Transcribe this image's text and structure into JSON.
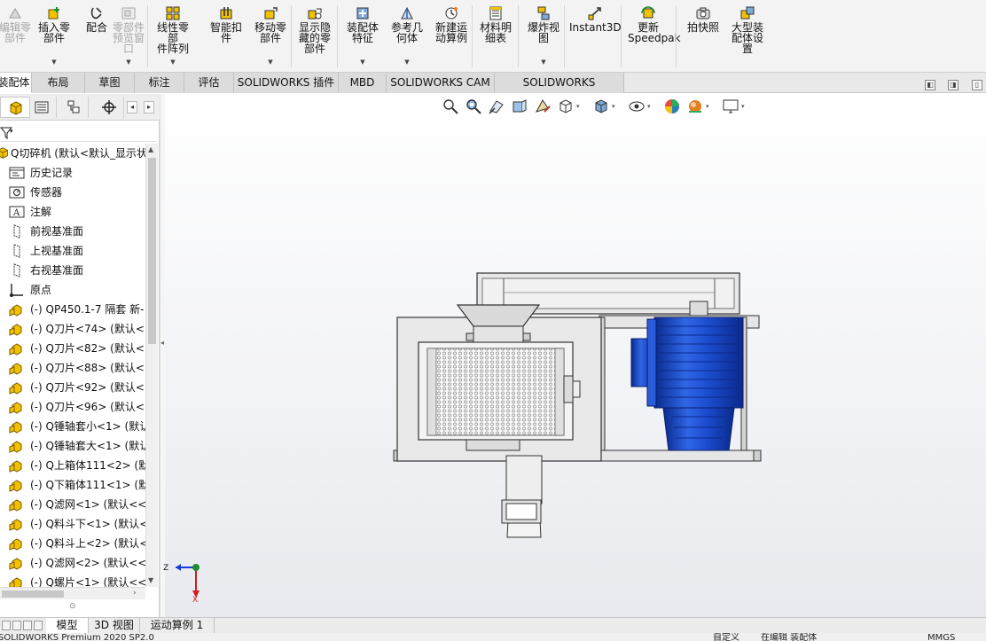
{
  "ribbon": {
    "buttons": [
      {
        "label": "编辑零\n部件",
        "icon": "edit-component-icon",
        "disabled": true
      },
      {
        "label": "插入零\n部件",
        "icon": "insert-component-icon",
        "disabled": false
      },
      {
        "label": "配合",
        "icon": "mate-icon",
        "disabled": false
      },
      {
        "label": "零部件\n预览窗\n口",
        "icon": "component-preview-icon",
        "disabled": true
      },
      {
        "label": "线性零部\n件阵列",
        "icon": "linear-pattern-icon",
        "disabled": false
      },
      {
        "label": "智能扣\n件",
        "icon": "smart-fasteners-icon",
        "disabled": false
      },
      {
        "label": "移动零\n部件",
        "icon": "move-component-icon",
        "disabled": false
      },
      {
        "label": "显示隐\n藏的零\n部件",
        "icon": "show-hidden-icon",
        "disabled": false
      },
      {
        "label": "装配体\n特征",
        "icon": "assembly-features-icon",
        "disabled": false
      },
      {
        "label": "参考几\n何体",
        "icon": "reference-geometry-icon",
        "disabled": false
      },
      {
        "label": "新建运\n动算例",
        "icon": "new-motion-study-icon",
        "disabled": false
      },
      {
        "label": "材料明\n细表",
        "icon": "bill-of-materials-icon",
        "disabled": false
      },
      {
        "label": "爆炸视\n图",
        "icon": "exploded-view-icon",
        "disabled": false
      },
      {
        "label": "Instant3D",
        "icon": "instant3d-icon",
        "disabled": false
      },
      {
        "label": "更新\nSpeedpak",
        "icon": "update-speedpak-icon",
        "disabled": false
      },
      {
        "label": "拍快照",
        "icon": "snapshot-icon",
        "disabled": false
      },
      {
        "label": "大型装\n配体设\n置",
        "icon": "large-assembly-settings-icon",
        "disabled": false
      }
    ]
  },
  "tabs": [
    "装配体",
    "布局",
    "草图",
    "标注",
    "评估",
    "SOLIDWORKS 插件",
    "MBD",
    "SOLIDWORKS CAM",
    "SOLIDWORKS Inspection"
  ],
  "tree": {
    "root": "Q切碎机 (默认<默认_显示状",
    "items": [
      {
        "label": "历史记录",
        "icon": "history-folder-icon"
      },
      {
        "label": "传感器",
        "icon": "sensor-icon"
      },
      {
        "label": "注解",
        "icon": "annotation-icon"
      },
      {
        "label": "前视基准面",
        "icon": "plane-icon"
      },
      {
        "label": "上视基准面",
        "icon": "plane-icon"
      },
      {
        "label": "右视基准面",
        "icon": "plane-icon"
      },
      {
        "label": "原点",
        "icon": "origin-icon"
      },
      {
        "label": "(-) QP450.1-7 隔套  新-",
        "icon": "part-icon"
      },
      {
        "label": "(-) Q刀片<74> (默认<<",
        "icon": "part-icon"
      },
      {
        "label": "(-) Q刀片<82> (默认<<",
        "icon": "part-icon"
      },
      {
        "label": "(-) Q刀片<88> (默认<<",
        "icon": "part-icon"
      },
      {
        "label": "(-) Q刀片<92> (默认<<",
        "icon": "part-icon"
      },
      {
        "label": "(-) Q刀片<96> (默认<<",
        "icon": "part-icon"
      },
      {
        "label": "(-) Q锤轴套小<1> (默认",
        "icon": "part-icon"
      },
      {
        "label": "(-) Q锤轴套大<1> (默认",
        "icon": "part-icon"
      },
      {
        "label": "(-) Q上箱体111<2> (默",
        "icon": "part-icon"
      },
      {
        "label": "(-) Q下箱体111<1> (默",
        "icon": "part-icon"
      },
      {
        "label": "(-) Q滤网<1> (默认<<默",
        "icon": "part-icon"
      },
      {
        "label": "(-) Q料斗下<1> (默认<",
        "icon": "part-icon"
      },
      {
        "label": "(-) Q料斗上<2> (默认<",
        "icon": "part-icon"
      },
      {
        "label": "(-) Q滤网<2> (默认<<默",
        "icon": "part-icon"
      },
      {
        "label": "(-) Q螺片<1> (默认<<",
        "icon": "part-icon"
      }
    ]
  },
  "bottom_tabs": [
    "模型",
    "3D 视图",
    "运动算例 1"
  ],
  "status": {
    "left": "SOLIDWORKS Premium 2020 SP2.0",
    "right1": "自定义",
    "right2": "在编辑 装配体",
    "right3": "MMGS"
  },
  "triad": {
    "z": "Z",
    "x": "X"
  },
  "colors": {
    "motor_blue": "#1f4fd0",
    "ribbon_bg": "#f3f3f3"
  }
}
